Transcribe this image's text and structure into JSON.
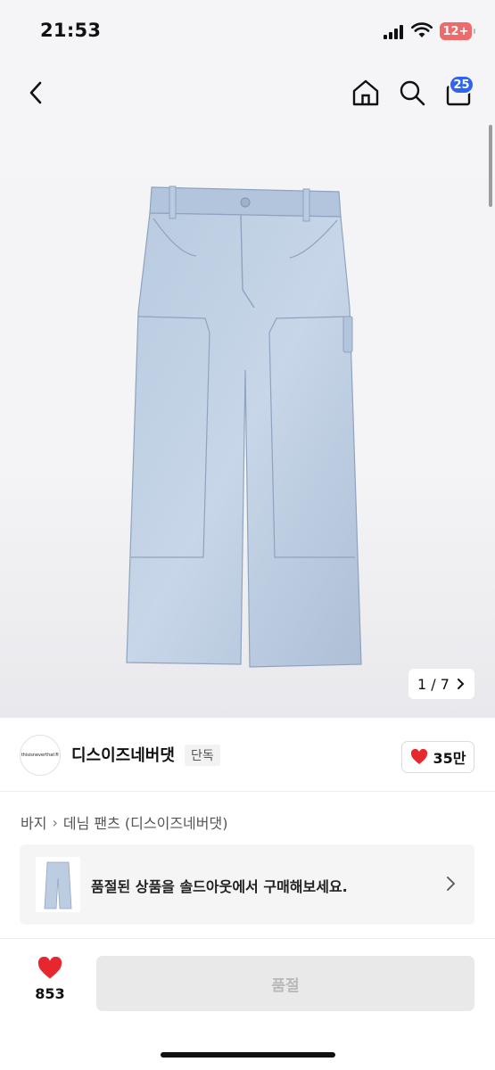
{
  "status_bar": {
    "time": "21:53",
    "battery": "12+"
  },
  "nav": {
    "cart_count": "25"
  },
  "gallery": {
    "counter": "1 / 7",
    "product_image_icon": "denim-pants-image"
  },
  "brand": {
    "logo_text": "thisisneverthat®",
    "name": "디스이즈네버댓",
    "exclusive_label": "단독",
    "likes": "35만",
    "heart_color": "#e8262d"
  },
  "breadcrumb": {
    "category": "바지",
    "subcategory": "데님 팬츠 (디스이즈네버댓)"
  },
  "soldout_banner": {
    "message": "품절된 상품을 솔드아웃에서 구매해보세요."
  },
  "bottom_bar": {
    "wish_count": "853",
    "buy_label": "품절"
  },
  "colors": {
    "accent": "#2f64ef",
    "heart": "#e8262d",
    "battery": "#ef6b6b"
  }
}
